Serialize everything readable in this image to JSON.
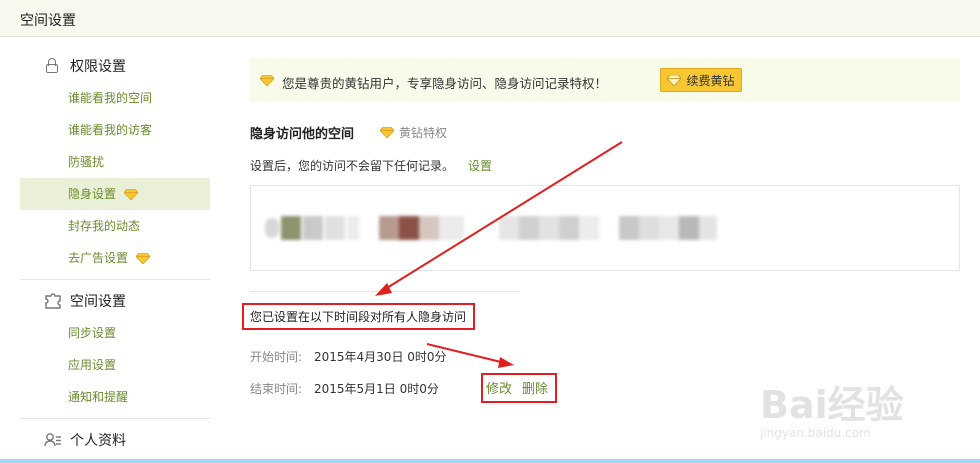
{
  "header": {
    "title": "空间设置"
  },
  "sidebar": {
    "sections": [
      {
        "title": "权限设置",
        "icon": "lock-icon",
        "items": [
          {
            "label": "谁能看我的空间",
            "diamond": false,
            "active": false
          },
          {
            "label": "谁能看我的访客",
            "diamond": false,
            "active": false
          },
          {
            "label": "防骚扰",
            "diamond": false,
            "active": false
          },
          {
            "label": "隐身设置",
            "diamond": true,
            "active": true
          },
          {
            "label": "封存我的动态",
            "diamond": false,
            "active": false
          },
          {
            "label": "去广告设置",
            "diamond": true,
            "active": false
          }
        ]
      },
      {
        "title": "空间设置",
        "icon": "puzzle-icon",
        "items": [
          {
            "label": "同步设置"
          },
          {
            "label": "应用设置"
          },
          {
            "label": "通知和提醒"
          }
        ]
      },
      {
        "title": "个人资料",
        "icon": "user-card-icon",
        "items": []
      }
    ]
  },
  "banner": {
    "text": "您是尊贵的黄钻用户，专享隐身访问、隐身访问记录特权！",
    "button_label": "续费黄钻"
  },
  "section": {
    "title": "隐身访问他的空间",
    "vip_label": "黄钻特权",
    "description": "设置后，您的访问不会留下任何记录。",
    "set_link": "设置"
  },
  "schedule": {
    "notice": "您已设置在以下时间段对所有人隐身访问",
    "start_label": "开始时间:",
    "start_value": "2015年4月30日 0时0分",
    "end_label": "结束时间:",
    "end_value": "2015年5月1日 0时0分",
    "edit_label": "修改",
    "delete_label": "删除"
  },
  "watermark": {
    "brand": "Bai经验",
    "url": "jingyan.baidu.com"
  },
  "colors": {
    "accent_green": "#6a8c2d",
    "diamond_yellow": "#f6c633",
    "annotation_red": "#e02020",
    "active_bg": "#eaf0d7"
  }
}
